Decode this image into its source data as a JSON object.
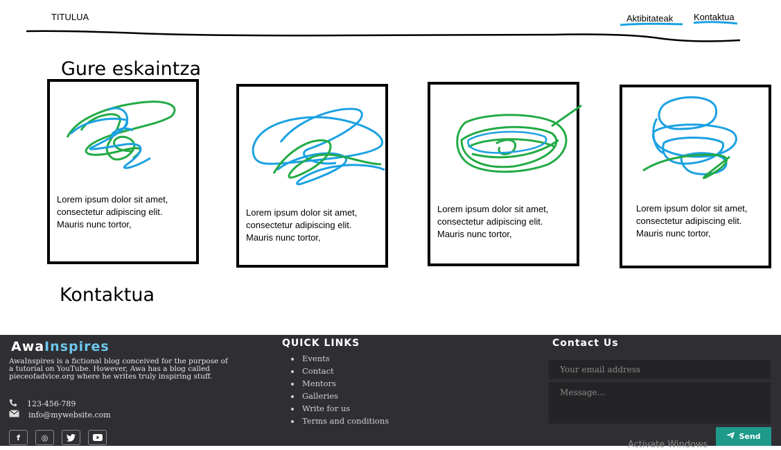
{
  "header": {
    "title": "TITULUA",
    "nav": [
      {
        "label": "Aktibitateak"
      },
      {
        "label": "Kontaktua"
      }
    ]
  },
  "offers": {
    "heading": "Gure eskaintza",
    "cards": [
      {
        "text": "Lorem ipsum dolor sit amet, consectetur adipiscing elit. Mauris nunc tortor,"
      },
      {
        "text": "Lorem ipsum dolor sit amet, consectetur adipiscing elit. Mauris nunc tortor,"
      },
      {
        "text": "Lorem ipsum dolor sit amet, consectetur adipiscing elit. Mauris nunc tortor,"
      },
      {
        "text": "Lorem ipsum dolor sit amet, consectetur adipiscing elit. Mauris nunc tortor,"
      }
    ]
  },
  "contact_section": {
    "heading": "Kontaktua"
  },
  "footer": {
    "brand_part1": "Awa",
    "brand_part2": "Inspires",
    "about": "AwaInspires is a fictional blog conceived for the purpose of a tutorial on YouTube. However, Awa has a blog called pieceofadvice.org where he writes truly inspiring stuff.",
    "phone": "123-456-789",
    "email": "info@mywebsite.com",
    "social": [
      {
        "icon": "facebook-icon",
        "glyph": "f"
      },
      {
        "icon": "instagram-icon",
        "glyph": "◎"
      },
      {
        "icon": "twitter-icon",
        "glyph": "🐦"
      },
      {
        "icon": "youtube-icon",
        "glyph": "▶"
      }
    ],
    "quick_links_heading": "QUICK LINKS",
    "quick_links": [
      "Events",
      "Contact",
      "Mentors",
      "Galleries",
      "Write for us",
      "Terms and conditions"
    ],
    "contact_heading": "Contact Us",
    "email_placeholder": "Your email address",
    "message_placeholder": "Message...",
    "send_label": "Send",
    "watermark": "Activate Windows"
  },
  "colors": {
    "footer_bg": "#2f2f33",
    "brand_accent": "#6ec6ec",
    "send_button": "#1f9a8a",
    "underline_blue": "#1ba1e2",
    "scribble_green": "#22aa44"
  }
}
